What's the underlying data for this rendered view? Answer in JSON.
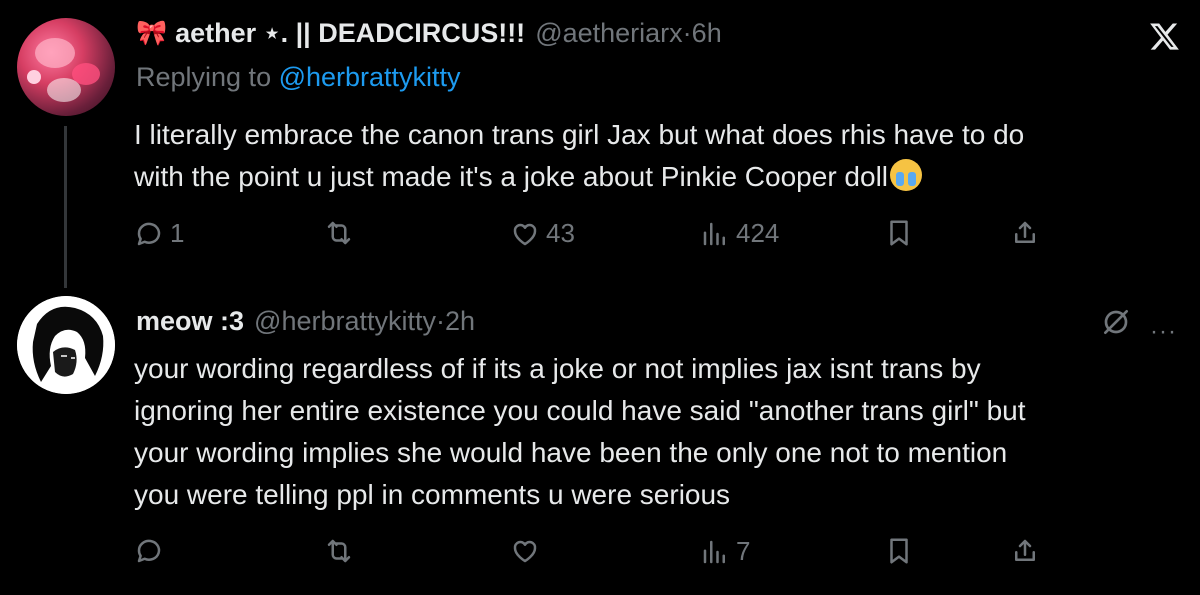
{
  "tweets": [
    {
      "display_name": "aether ⋆. || DEADCIRCUS!!!",
      "handle": "@aetheriarx",
      "separator": "·",
      "time": "6h",
      "replying_prefix": "Replying to ",
      "replying_to": "@herbrattykitty",
      "text_line1": "I literally embrace the canon trans girl Jax but what does rhis have to do",
      "text_line2": "with the point u just made it's a joke about Pinkie Cooper doll",
      "emoji": "loudly-crying-face",
      "replies": "1",
      "retweets": "",
      "likes": "43",
      "views": "424"
    },
    {
      "display_name": "meow :3",
      "handle": "@herbrattykitty",
      "separator": "·",
      "time": "2h",
      "text_line1": "your wording regardless of if its a joke or not implies jax isnt trans by",
      "text_line2": "ignoring her entire existence you could have said \"another trans girl\" but",
      "text_line3": "your wording implies she would have been the only one not to mention",
      "text_line4": "you were telling ppl in comments u were serious",
      "replies": "",
      "retweets": "",
      "likes": "",
      "views": "7"
    }
  ],
  "icons": {
    "bow": "🎀",
    "more": "···"
  },
  "colors": {
    "background": "#000000",
    "text": "#e7e9ea",
    "muted": "#71767b",
    "link": "#1d9bf0",
    "thread_line": "#333639"
  }
}
